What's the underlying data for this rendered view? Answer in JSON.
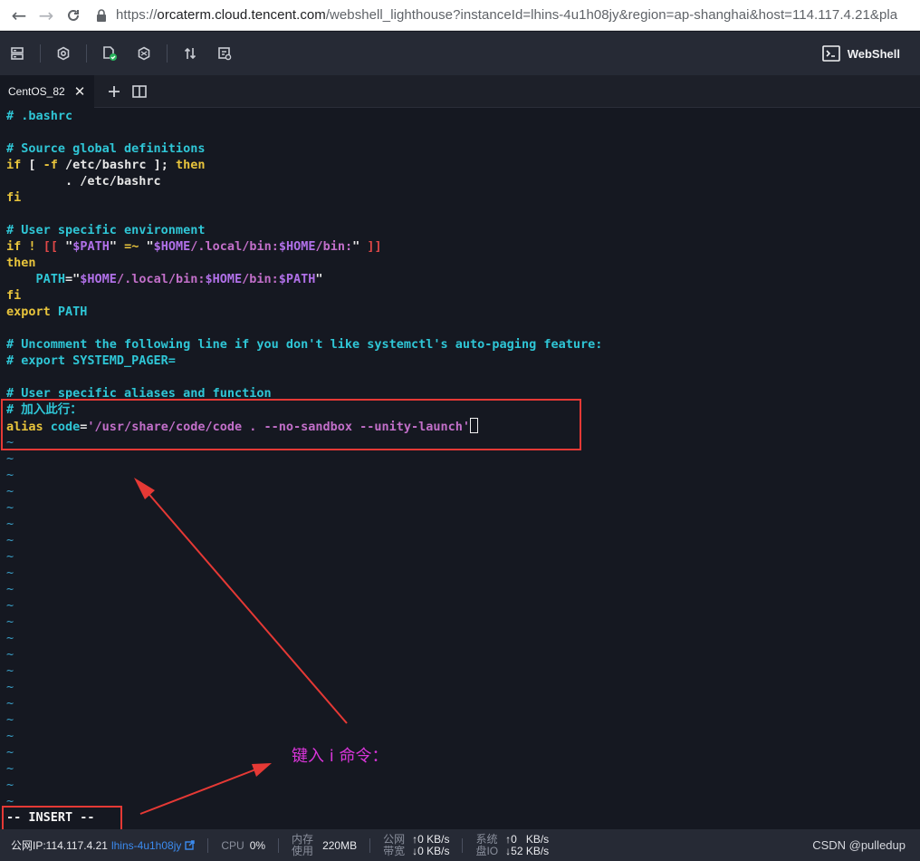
{
  "browser": {
    "url_prefix": "https://",
    "url_host": "orcaterm.cloud.tencent.com",
    "url_rest": "/webshell_lighthouse?instanceId=lhins-4u1h08jy&region=ap-shanghai&host=114.117.4.21&pla",
    "icons": [
      "back-arrow-icon",
      "forward-arrow-icon",
      "reload-icon",
      "lock-icon"
    ]
  },
  "toolbar": {
    "webshell_label": "WebShell",
    "icons": [
      "server-list-icon",
      "settings-icon",
      "file-check-icon",
      "command-icon",
      "transfer-icon",
      "history-icon",
      "terminal-icon"
    ]
  },
  "tabs": [
    {
      "label": "CentOS_82",
      "close": "✕"
    }
  ],
  "terminal": {
    "lines": [
      {
        "segments": [
          {
            "t": "# .bashrc",
            "c": "comment"
          }
        ]
      },
      {
        "segments": []
      },
      {
        "segments": [
          {
            "t": "# Source global definitions",
            "c": "comment"
          }
        ]
      },
      {
        "segments": [
          {
            "t": "if",
            "c": "kw"
          },
          {
            "t": " [ ",
            "c": "white"
          },
          {
            "t": "-f",
            "c": "kw"
          },
          {
            "t": " /etc/bashrc ]; ",
            "c": "white"
          },
          {
            "t": "then",
            "c": "kw"
          }
        ]
      },
      {
        "segments": [
          {
            "t": "        . /etc/bashrc",
            "c": "white"
          }
        ]
      },
      {
        "segments": [
          {
            "t": "fi",
            "c": "kw"
          }
        ]
      },
      {
        "segments": []
      },
      {
        "segments": [
          {
            "t": "# User specific environment",
            "c": "comment"
          }
        ]
      },
      {
        "segments": [
          {
            "t": "if",
            "c": "kw"
          },
          {
            "t": " ",
            "c": "white"
          },
          {
            "t": "!",
            "c": "kw"
          },
          {
            "t": " ",
            "c": "white"
          },
          {
            "t": "[[",
            "c": "red"
          },
          {
            "t": " \"",
            "c": "white"
          },
          {
            "t": "$PATH",
            "c": "var"
          },
          {
            "t": "\" ",
            "c": "white"
          },
          {
            "t": "=~",
            "c": "kw"
          },
          {
            "t": " \"",
            "c": "white"
          },
          {
            "t": "$HOME",
            "c": "var"
          },
          {
            "t": "/.local/bin:",
            "c": "str"
          },
          {
            "t": "$HOME",
            "c": "var"
          },
          {
            "t": "/bin:",
            "c": "str"
          },
          {
            "t": "\" ",
            "c": "white"
          },
          {
            "t": "]]",
            "c": "red"
          }
        ]
      },
      {
        "segments": [
          {
            "t": "then",
            "c": "kw"
          }
        ]
      },
      {
        "segments": [
          {
            "t": "    PATH",
            "c": "comment"
          },
          {
            "t": "=\"",
            "c": "white"
          },
          {
            "t": "$HOME",
            "c": "var"
          },
          {
            "t": "/.local/bin:",
            "c": "str"
          },
          {
            "t": "$HOME",
            "c": "var"
          },
          {
            "t": "/bin:",
            "c": "str"
          },
          {
            "t": "$PATH",
            "c": "var"
          },
          {
            "t": "\"",
            "c": "white"
          }
        ]
      },
      {
        "segments": [
          {
            "t": "fi",
            "c": "kw"
          }
        ]
      },
      {
        "segments": [
          {
            "t": "export",
            "c": "kw"
          },
          {
            "t": " PATH",
            "c": "comment"
          }
        ]
      },
      {
        "segments": []
      },
      {
        "segments": [
          {
            "t": "# Uncomment the following line if you don't like systemctl's auto-paging feature:",
            "c": "comment"
          }
        ]
      },
      {
        "segments": [
          {
            "t": "# export SYSTEMD_PAGER=",
            "c": "comment"
          }
        ]
      },
      {
        "segments": []
      },
      {
        "segments": [
          {
            "t": "# User specific aliases and function",
            "c": "comment"
          }
        ]
      },
      {
        "segments": [
          {
            "t": "# 加入此行：",
            "c": "comment"
          }
        ]
      },
      {
        "segments": [
          {
            "t": "alias",
            "c": "kw"
          },
          {
            "t": " code",
            "c": "comment"
          },
          {
            "t": "=",
            "c": "white"
          },
          {
            "t": "'/usr/share/code/code . --no-sandbox --unity-launch'",
            "c": "str"
          }
        ],
        "cursor": true
      }
    ],
    "tilde_count": 23,
    "tilde_char": "~",
    "mode_line": "-- INSERT --"
  },
  "annotations": {
    "instruction": "键入 i 命令：",
    "color": "#e53935"
  },
  "status_bar": {
    "public_ip": "公网IP:114.117.4.21",
    "instance_id": "lhins-4u1h08jy",
    "cpu_label": "CPU",
    "cpu_value": "0%",
    "mem_label_1": "内存",
    "mem_label_2": "使用",
    "mem_value": "220MB",
    "net_label_1": "公网",
    "net_label_2": "带宽",
    "net_up": "↑0 KB/s",
    "net_down": "↓0 KB/s",
    "disk_label_1": "系统",
    "disk_label_2": "盘IO",
    "disk_up": "↑0   KB/s",
    "disk_down": "↓52 KB/s",
    "credit": "CSDN @pulledup"
  }
}
